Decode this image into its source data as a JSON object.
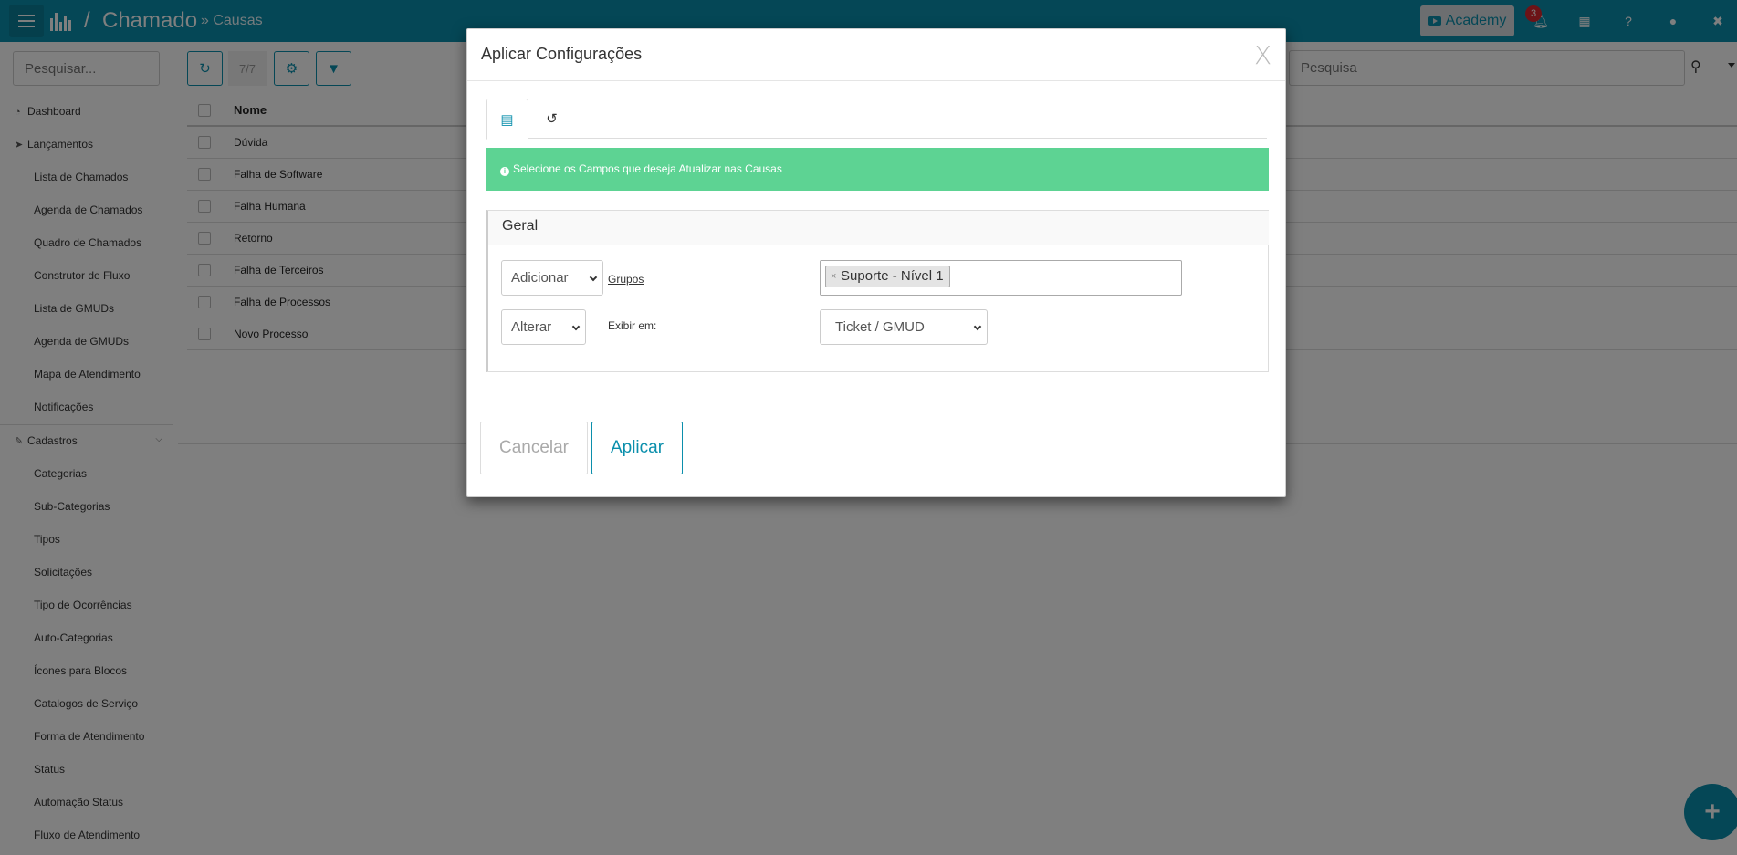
{
  "topbar": {
    "title": "Chamado",
    "separator": "/",
    "subtitle": "» Causas",
    "academy_label": "Academy",
    "notification_count": "3"
  },
  "sidebar": {
    "search_placeholder": "Pesquisar...",
    "groups": [
      {
        "label": "Dashboard",
        "icon": "dashboard-icon"
      },
      {
        "label": "Lançamentos",
        "icon": "send-icon",
        "items": [
          "Lista de Chamados",
          "Agenda de Chamados",
          "Quadro de Chamados",
          "Construtor de Fluxo",
          "Lista de GMUDs",
          "Agenda de GMUDs",
          "Mapa de Atendimento",
          "Notificações"
        ]
      },
      {
        "label": "Cadastros",
        "icon": "edit-icon",
        "items": [
          "Categorias",
          "Sub-Categorias",
          "Tipos",
          "Solicitações",
          "Tipo de Ocorrências",
          "Auto-Categorias",
          "Ícones para Blocos",
          "Catalogos de Serviço",
          "Forma de Atendimento",
          "Status",
          "Automação Status",
          "Fluxo de Atendimento"
        ]
      }
    ]
  },
  "toolbar": {
    "pager": "7/7",
    "search_placeholder": "Pesquisa"
  },
  "table": {
    "header_name": "Nome",
    "rows": [
      "Dúvida",
      "Falha de Software",
      "Falha Humana",
      "Retorno",
      "Falha de Terceiros",
      "Falha de Processos",
      "Novo Processo"
    ]
  },
  "modal": {
    "title": "Aplicar Configurações",
    "close": "X",
    "alert": "Selecione os Campos que deseja Atualizar nas Causas",
    "panel_title": "Geral",
    "row1": {
      "action": "Adicionar",
      "label": "Grupos",
      "tag": "Suporte - Nível 1"
    },
    "row2": {
      "action": "Alterar",
      "label": "Exibir em:",
      "value": "Ticket / GMUD"
    },
    "cancel_label": "Cancelar",
    "apply_label": "Aplicar"
  },
  "colors": {
    "primary": "#0b8fac",
    "success": "#5dd393",
    "danger": "#d9262e"
  }
}
